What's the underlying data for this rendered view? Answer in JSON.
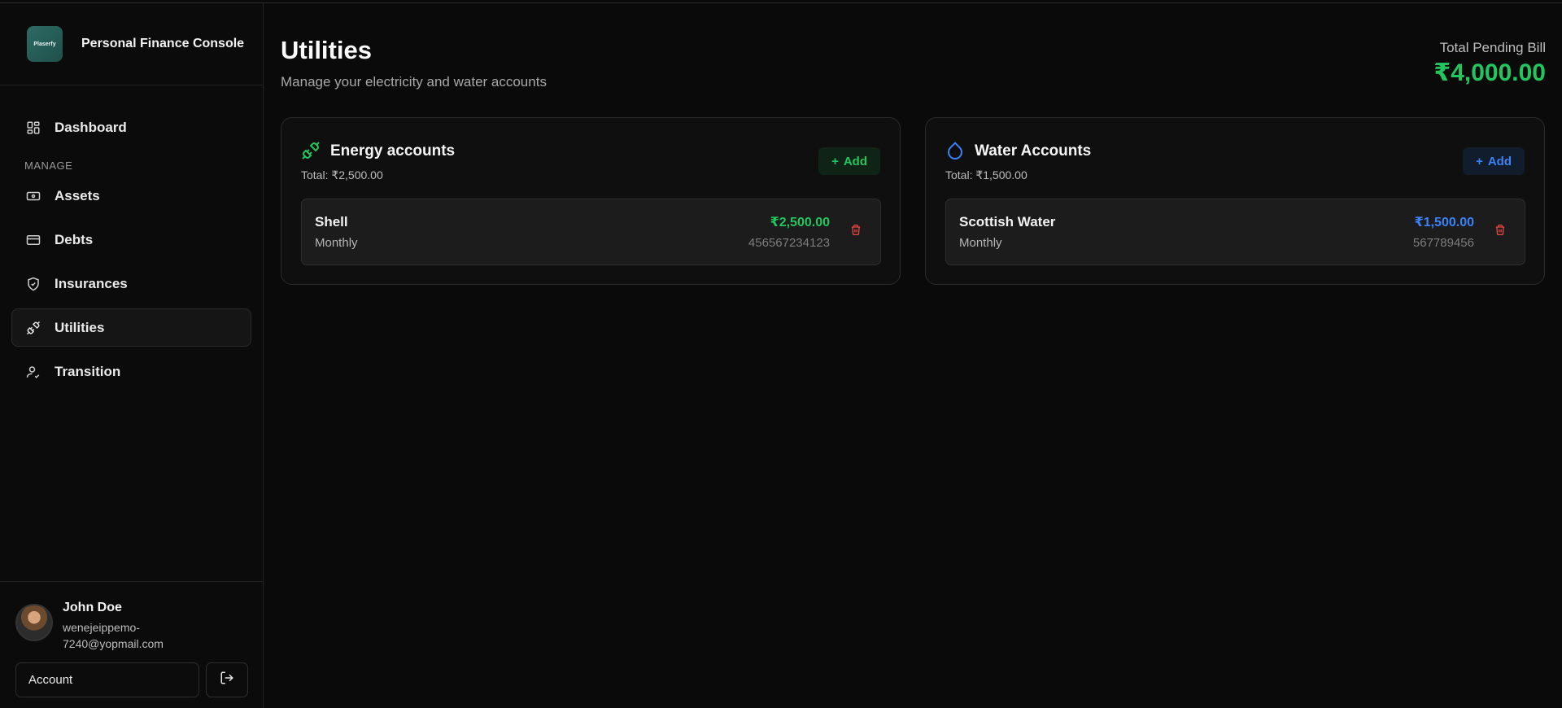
{
  "app": {
    "name": "Personal Finance Console",
    "logo_text": "Plaserfy"
  },
  "sidebar": {
    "items": [
      {
        "label": "Dashboard",
        "icon": "dashboard-icon"
      },
      {
        "label": "Assets",
        "icon": "banknote-icon"
      },
      {
        "label": "Debts",
        "icon": "credit-card-icon"
      },
      {
        "label": "Insurances",
        "icon": "shield-check-icon"
      },
      {
        "label": "Utilities",
        "icon": "plug-icon",
        "active": true
      },
      {
        "label": "Transition",
        "icon": "user-check-icon"
      }
    ],
    "section_label": "MANAGE"
  },
  "user": {
    "name": "John Doe",
    "email": "wenejeippemo-7240@yopmail.com",
    "account_label": "Account",
    "logout_icon": "logout-icon"
  },
  "page": {
    "title": "Utilities",
    "subtitle": "Manage your electricity and water accounts",
    "pending_label": "Total Pending Bill",
    "pending_value": "₹4,000.00"
  },
  "energy": {
    "title": "Energy accounts",
    "total": "Total: ₹2,500.00",
    "add_label": "Add",
    "accent": "#22c55e",
    "accounts": [
      {
        "name": "Shell",
        "frequency": "Monthly",
        "amount": "₹2,500.00",
        "number": "456567234123"
      }
    ]
  },
  "water": {
    "title": "Water Accounts",
    "total": "Total: ₹1,500.00",
    "add_label": "Add",
    "accent": "#3b82f6",
    "accounts": [
      {
        "name": "Scottish Water",
        "frequency": "Monthly",
        "amount": "₹1,500.00",
        "number": "567789456"
      }
    ]
  }
}
